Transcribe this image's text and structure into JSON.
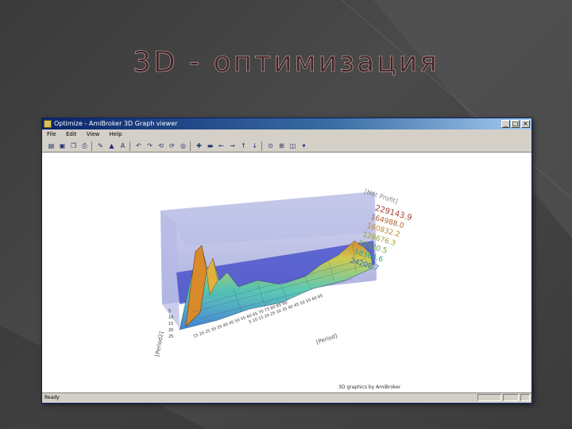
{
  "slide": {
    "title": "3D - оптимизация"
  },
  "window": {
    "title": "Optimize - AmiBroker 3D Graph viewer",
    "menu": [
      "File",
      "Edit",
      "View",
      "Help"
    ],
    "status_text": "Ready",
    "footer_credit": "3D graphics by AmiBroker"
  },
  "graph": {
    "z_axis_title": "[Net Profit]",
    "z_ticks": [
      "229143.9",
      "164988.0",
      "160832.2",
      "126676.3",
      "92520.5",
      "58364.6",
      "24208.7"
    ],
    "x_axis_title": "[Period]",
    "y_axis_title": "[Period2]",
    "colors": {
      "box_top": "#9aa0d8",
      "box_side": "#b8bce6",
      "plane": "#3c46c8",
      "surface_low": "#3a7bd5",
      "surface_mid": "#56c9b0",
      "surface_high": "#d6d04a",
      "surface_peak": "#d98a2a"
    }
  }
}
